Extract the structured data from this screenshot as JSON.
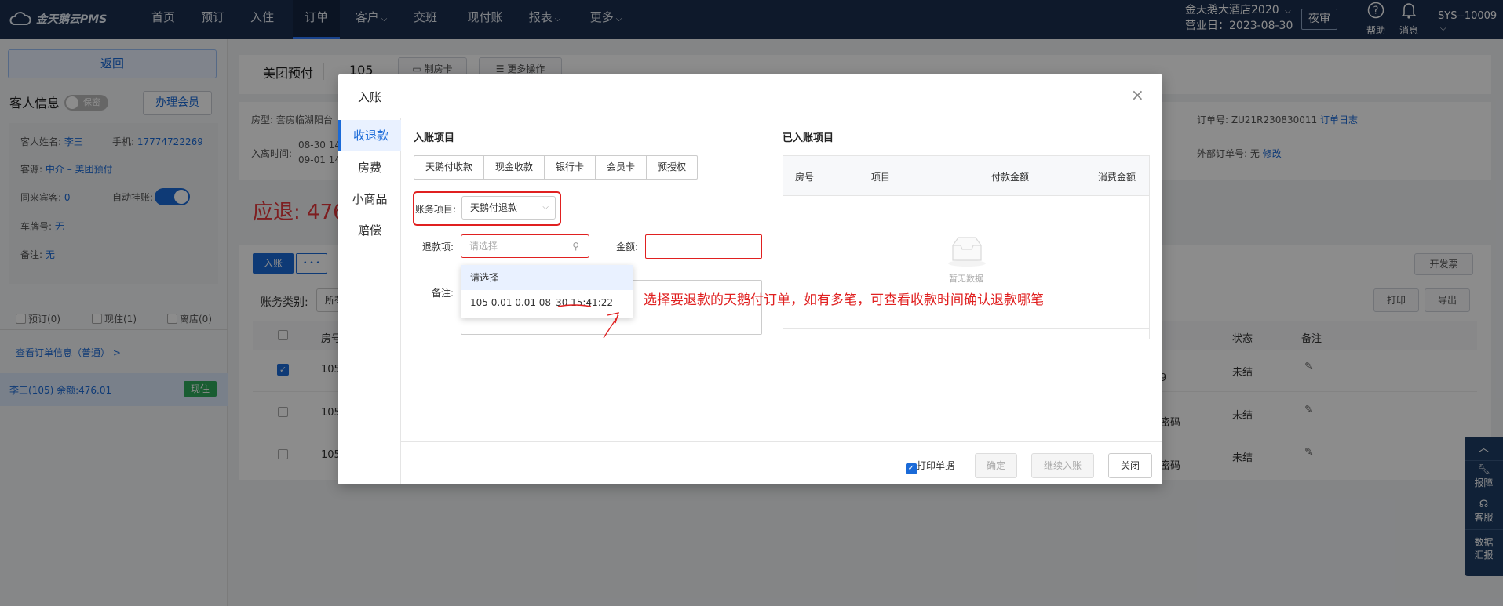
{
  "topnav": {
    "logo_text": "金天鹅云PMS",
    "items": [
      {
        "label": "首页"
      },
      {
        "label": "预订"
      },
      {
        "label": "入住"
      },
      {
        "label": "订单"
      },
      {
        "label": "客户"
      },
      {
        "label": "交班"
      },
      {
        "label": "现付账"
      },
      {
        "label": "报表"
      },
      {
        "label": "更多"
      }
    ],
    "active_index": 3,
    "hotel_name": "金天鹅大酒店2020",
    "business_date_label": "营业日：2023-08-30",
    "audit_button": "夜审",
    "help_label": "帮助",
    "message_label": "消息",
    "user": "SYS--10009"
  },
  "left": {
    "back_button": "返回",
    "guest_info_title": "客人信息",
    "secret_toggle": "保密",
    "member_button": "办理会员",
    "name_label": "客人姓名:",
    "name_value": "李三",
    "phone_label": "手机:",
    "phone_value": "17774722269",
    "source_label": "客源:",
    "source_value": "中介 – 美团预付",
    "companions_label": "同来宾客:",
    "companions_value": "0",
    "auto_hang_label": "自动挂账:",
    "plate_label": "车牌号:",
    "plate_value": "无",
    "remark_label": "备注:",
    "remark_value": "无",
    "filter_reserve": "预订(0)",
    "filter_checkin": "现住(1)",
    "filter_checkout": "离店(0)",
    "order_info_link": "查看订单信息（普通） >",
    "room_row_text": "李三(105)   余额:476.01",
    "room_row_status": "现住"
  },
  "main": {
    "order_type": "美团预付",
    "room_no": "105",
    "make_card_button": "制房卡",
    "more_ops_button": "更多操作",
    "room_type_label": "房型:",
    "room_type_value": "套房临湖阳台",
    "stay_time_label": "入离时间:",
    "stay_time_1": "08-30 14",
    "stay_time_2": "09-01 14",
    "order_no_label": "订单号:",
    "order_no_value": "ZU21R230830011",
    "order_log_link": "订单日志",
    "ext_order_label": "外部订单号:",
    "ext_order_value": "无",
    "ext_order_edit": "修改",
    "refund_big": "应退: 476",
    "checkin_account_button": "入账",
    "more_button": "• • •",
    "invoice_button": "开发票",
    "account_type_label": "账务类别:",
    "account_type_value": "所有",
    "print_button": "打印",
    "export_button": "导出",
    "col_room": "房号",
    "col_status": "状态",
    "col_remark": "备注",
    "rows": [
      {
        "room": "105",
        "extra": "9",
        "status": "未结"
      },
      {
        "room": "105",
        "extra": "密码",
        "status": "未结"
      },
      {
        "room": "105",
        "extra": "密码",
        "status": "未结"
      }
    ]
  },
  "floatbar": {
    "report_label": "报障",
    "service_label": "客服",
    "data_label_1": "数据",
    "data_label_2": "汇报"
  },
  "modal": {
    "title": "入账",
    "side_tabs": [
      {
        "label": "收退款"
      },
      {
        "label": "房费"
      },
      {
        "label": "小商品"
      },
      {
        "label": "赔偿"
      }
    ],
    "active_tab_index": 0,
    "left_section_title": "入账项目",
    "pay_buttons": [
      {
        "label": "天鹅付收款"
      },
      {
        "label": "现金收款"
      },
      {
        "label": "银行卡"
      },
      {
        "label": "会员卡"
      },
      {
        "label": "预授权"
      }
    ],
    "account_item_label": "账务项目:",
    "account_item_value": "天鹅付退款",
    "refund_item_label": "退款项:",
    "refund_item_placeholder": "请选择",
    "amount_label": "金额:",
    "remark_label": "备注:",
    "dropdown_options": [
      {
        "label": "请选择"
      },
      {
        "label": "105 0.01 0.01 08–30 15:41:22"
      }
    ],
    "right_section_title": "已入账项目",
    "table_headers": [
      {
        "label": "房号"
      },
      {
        "label": "项目"
      },
      {
        "label": "付款金额"
      },
      {
        "label": "消费金额"
      }
    ],
    "empty_text": "暂无数据",
    "print_receipt_label": "打印单据",
    "confirm_button": "确定",
    "continue_button": "继续入账",
    "close_button": "关闭"
  },
  "annotation": {
    "text": "选择要退款的天鹅付订单，如有多笔，可查看收款时间确认退款哪笔",
    "color": "#e02020"
  }
}
